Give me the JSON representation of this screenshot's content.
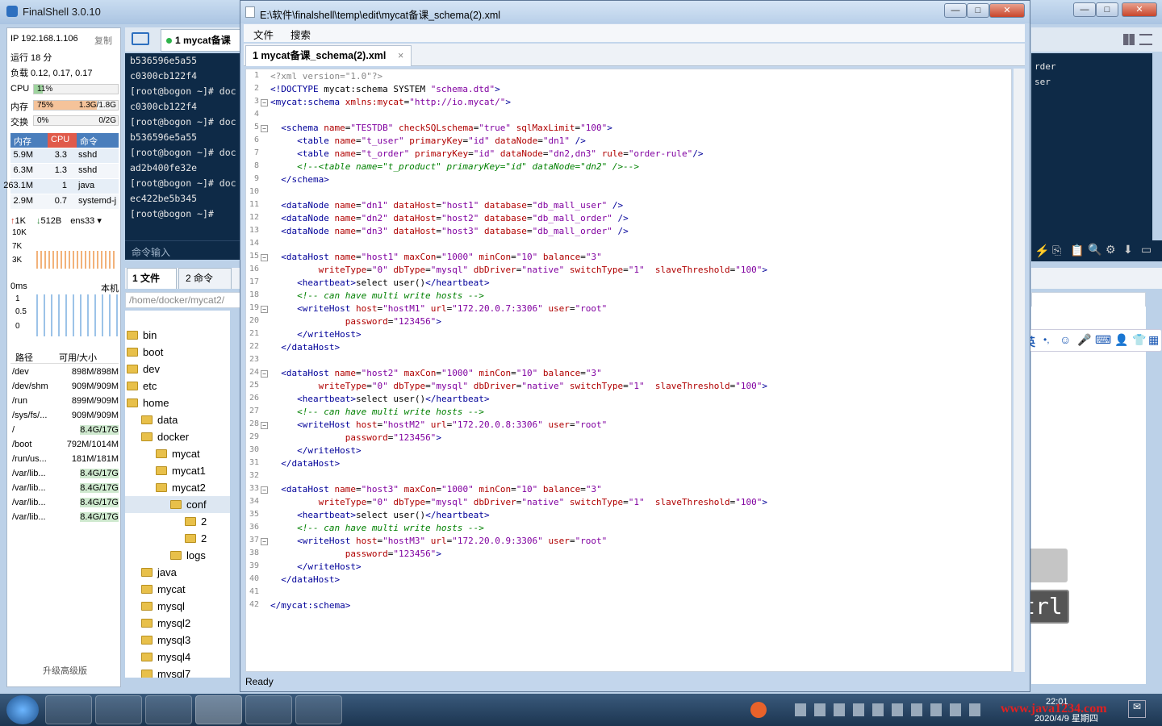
{
  "finalshell": {
    "title": "FinalShell 3.0.10",
    "ip": "IP 192.168.1.106",
    "copy": "复制",
    "uptime": "运行 18 分",
    "load": "负载 0.12, 0.17, 0.17",
    "cpu_label": "CPU",
    "cpu_value": "11%",
    "cpu_fraction": 0.11,
    "mem_label": "内存",
    "mem_value": "75%",
    "mem_fraction": 0.75,
    "mem_amount": "1.3G/1.8G",
    "swap_label": "交换",
    "swap_value": "0%",
    "swap_amount": "0/2G",
    "proc_headers": [
      "内存",
      "CPU",
      "命令"
    ],
    "processes": [
      {
        "mem": "5.9M",
        "cpu": "3.3",
        "cmd": "sshd"
      },
      {
        "mem": "6.3M",
        "cpu": "1.3",
        "cmd": "sshd"
      },
      {
        "mem": "263.1M",
        "cpu": "1",
        "cmd": "java"
      },
      {
        "mem": "2.9M",
        "cpu": "0.7",
        "cmd": "systemd-j"
      }
    ],
    "net_up": "1K",
    "net_down": "512B",
    "net_iface": "ens33",
    "net_axis": [
      "10K",
      "7K",
      "3K"
    ],
    "ping_label": "0ms",
    "ping_host": "本机",
    "ping_axis": [
      "1",
      "0.5",
      "0"
    ],
    "disk_headers": [
      "路径",
      "可用/大小"
    ],
    "disks": [
      {
        "path": "/dev",
        "size": "898M/898M"
      },
      {
        "path": "/dev/shm",
        "size": "909M/909M"
      },
      {
        "path": "/run",
        "size": "899M/909M"
      },
      {
        "path": "/sys/fs/...",
        "size": "909M/909M"
      },
      {
        "path": "/",
        "size": "8.4G/17G"
      },
      {
        "path": "/boot",
        "size": "792M/1014M"
      },
      {
        "path": "/run/us...",
        "size": "181M/181M"
      },
      {
        "path": "/var/lib...",
        "size": "8.4G/17G"
      },
      {
        "path": "/var/lib...",
        "size": "8.4G/17G"
      },
      {
        "path": "/var/lib...",
        "size": "8.4G/17G"
      },
      {
        "path": "/var/lib...",
        "size": "8.4G/17G"
      }
    ],
    "upgrade": "升级高级版",
    "session_tab": "1 mycat备课",
    "terminal_lines": [
      "b536596e5a55",
      "c0300cb122f4",
      "[root@bogon ~]# doc",
      "c0300cb122f4",
      "[root@bogon ~]# doc",
      "b536596e5a55",
      "[root@bogon ~]# doc",
      "ad2b400fe32e",
      "[root@bogon ~]# doc",
      "ec422be5b345",
      "[root@bogon ~]# "
    ],
    "cmd_input": "命令输入",
    "file_tab": "1 文件",
    "cmd_tab": "2 命令",
    "path": "/home/docker/mycat2/",
    "tree": [
      {
        "name": "bin",
        "depth": 0
      },
      {
        "name": "boot",
        "depth": 0
      },
      {
        "name": "dev",
        "depth": 0
      },
      {
        "name": "etc",
        "depth": 0
      },
      {
        "name": "home",
        "depth": 0
      },
      {
        "name": "data",
        "depth": 1
      },
      {
        "name": "docker",
        "depth": 1
      },
      {
        "name": "mycat",
        "depth": 2
      },
      {
        "name": "mycat1",
        "depth": 2
      },
      {
        "name": "mycat2",
        "depth": 2
      },
      {
        "name": "conf",
        "depth": 3
      },
      {
        "name": "2",
        "depth": 4
      },
      {
        "name": "2",
        "depth": 4
      },
      {
        "name": "logs",
        "depth": 3
      },
      {
        "name": "java",
        "depth": 1
      },
      {
        "name": "mycat",
        "depth": 1
      },
      {
        "name": "mysql",
        "depth": 1
      },
      {
        "name": "mysql2",
        "depth": 1
      },
      {
        "name": "mysql3",
        "depth": 1
      },
      {
        "name": "mysql4",
        "depth": 1
      },
      {
        "name": "mysql7",
        "depth": 1
      }
    ],
    "right_term_lines": [
      "rder",
      "ser"
    ]
  },
  "editor": {
    "title": "E:\\软件\\finalshell\\temp\\edit\\mycat备课_schema(2).xml",
    "menu": [
      "文件",
      "搜索"
    ],
    "tab": "1 mycat备课_schema(2).xml",
    "status": "Ready",
    "lines": [
      "<?xml version=\"1.0\"?>",
      "<!DOCTYPE mycat:schema SYSTEM \"schema.dtd\">",
      "<mycat:schema xmlns:mycat=\"http://io.mycat/\">",
      "",
      "  <schema name=\"TESTDB\" checkSQLschema=\"true\" sqlMaxLimit=\"100\">",
      "     <table name=\"t_user\" primaryKey=\"id\" dataNode=\"dn1\" />",
      "     <table name=\"t_order\" primaryKey=\"id\" dataNode=\"dn2,dn3\" rule=\"order-rule\"/>",
      "     <!--<table name=\"t_product\" primaryKey=\"id\" dataNode=\"dn2\" />-->",
      "  </schema>",
      "",
      "  <dataNode name=\"dn1\" dataHost=\"host1\" database=\"db_mall_user\" />",
      "  <dataNode name=\"dn2\" dataHost=\"host2\" database=\"db_mall_order\" />",
      "  <dataNode name=\"dn3\" dataHost=\"host3\" database=\"db_mall_order\" />",
      "",
      "  <dataHost name=\"host1\" maxCon=\"1000\" minCon=\"10\" balance=\"3\"",
      "         writeType=\"0\" dbType=\"mysql\" dbDriver=\"native\" switchType=\"1\"  slaveThreshold=\"100\">",
      "     <heartbeat>select user()</heartbeat>",
      "     <!-- can have multi write hosts -->",
      "     <writeHost host=\"hostM1\" url=\"172.20.0.7:3306\" user=\"root\"",
      "              password=\"123456\">",
      "     </writeHost>",
      "  </dataHost>",
      "",
      "  <dataHost name=\"host2\" maxCon=\"1000\" minCon=\"10\" balance=\"3\"",
      "         writeType=\"0\" dbType=\"mysql\" dbDriver=\"native\" switchType=\"1\"  slaveThreshold=\"100\">",
      "     <heartbeat>select user()</heartbeat>",
      "     <!-- can have multi write hosts -->",
      "     <writeHost host=\"hostM2\" url=\"172.20.0.8:3306\" user=\"root\"",
      "              password=\"123456\">",
      "     </writeHost>",
      "  </dataHost>",
      "",
      "  <dataHost name=\"host3\" maxCon=\"1000\" minCon=\"10\" balance=\"3\"",
      "         writeType=\"0\" dbType=\"mysql\" dbDriver=\"native\" switchType=\"1\"  slaveThreshold=\"100\">",
      "     <heartbeat>select user()</heartbeat>",
      "     <!-- can have multi write hosts -->",
      "     <writeHost host=\"hostM3\" url=\"172.20.0.9:3306\" user=\"root\"",
      "              password=\"123456\">",
      "     </writeHost>",
      "  </dataHost>",
      "",
      "</mycat:schema>"
    ],
    "fold_lines": [
      3,
      5,
      15,
      19,
      24,
      28,
      33,
      37
    ]
  },
  "ime": {
    "mode": "英"
  },
  "overlay": {
    "key": "Ctrl"
  },
  "taskbar": {
    "time": "22:01",
    "date": "2020/4/9 星期四",
    "watermark": "www.java1234.com"
  },
  "colors": {
    "terminal_bg": "#0e2a47",
    "accent": "#2d6fbf"
  }
}
